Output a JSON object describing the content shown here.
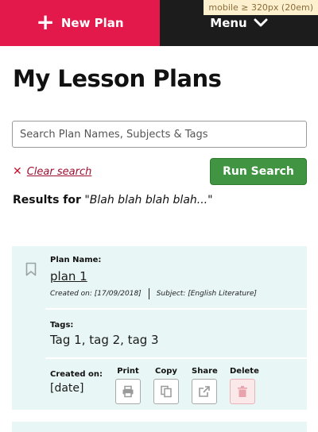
{
  "header": {
    "new_plan_label": "New Plan",
    "menu_label": "Menu",
    "breakpoint_note": "mobile ≥ 320px (20em)"
  },
  "page": {
    "title": "My Lesson Plans"
  },
  "search": {
    "placeholder": "Search Plan Names, Subjects & Tags",
    "value": "",
    "clear_label": "Clear search",
    "run_label": "Run Search",
    "results_prefix": "Results for",
    "results_query": "\"Blah blah blah blah...\""
  },
  "plans": [
    {
      "name_label": "Plan Name:",
      "name": "plan 1",
      "created_meta": "Created on: [17/09/2018]",
      "subject_meta": "Subject: [English Literature]",
      "tags_label": "Tags:",
      "tags": "Tag 1, tag 2, tag 3",
      "created_label": "Created on:",
      "created_value": "[date]",
      "actions": {
        "print": "Print",
        "copy": "Copy",
        "share": "Share",
        "delete": "Delete"
      }
    }
  ],
  "colors": {
    "primary_red": "#e3194b",
    "header_dark": "#1c1c1c",
    "run_green": "#419441",
    "card_bg": "#e8f6f5"
  },
  "icons": [
    "plus-icon",
    "chevron-down-icon",
    "bookmark-icon",
    "print-icon",
    "copy-icon",
    "share-icon",
    "trash-icon",
    "close-icon"
  ]
}
